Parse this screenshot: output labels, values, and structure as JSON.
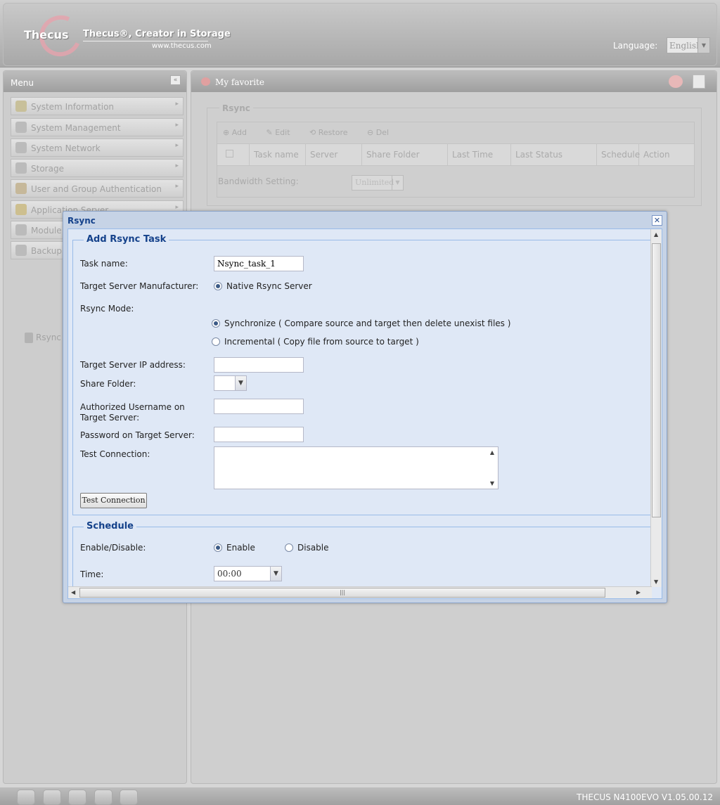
{
  "header": {
    "logo_text": "Thecus",
    "tagline": "Thecus®, Creator in Storage",
    "site_url": "www.thecus.com",
    "language_label": "Language:",
    "language_value": "English"
  },
  "menu": {
    "title": "Menu",
    "collapse_icon": "double-chevron-left",
    "items": [
      {
        "label": "System Information",
        "icon": "info-icon"
      },
      {
        "label": "System Management",
        "icon": "tools-icon"
      },
      {
        "label": "System Network",
        "icon": "network-icon"
      },
      {
        "label": "Storage",
        "icon": "storage-icon"
      },
      {
        "label": "User and Group Authentication",
        "icon": "users-icon"
      },
      {
        "label": "Application Server",
        "icon": "folder-icon"
      },
      {
        "label": "Module M",
        "icon": "gear-icon"
      },
      {
        "label": "Backup",
        "icon": "backup-icon"
      }
    ],
    "sub_item": "Rsync"
  },
  "main": {
    "favorite_label": "My favorite",
    "group_title": "Rsync",
    "toolbar": [
      "Add",
      "Edit",
      "Restore",
      "Del"
    ],
    "columns": [
      "Task name",
      "Server",
      "Share Folder",
      "Last Time",
      "Last Status",
      "Schedule",
      "Action"
    ],
    "bandwidth_label": "Bandwidth Setting:",
    "bandwidth_value": "Unlimited"
  },
  "dialog": {
    "title": "Rsync",
    "add_task_legend": "Add Rsync Task",
    "task_name_label": "Task name:",
    "task_name_value": "Nsync_task_1",
    "manufacturer_label": "Target Server Manufacturer:",
    "manufacturer_option": "Native Rsync Server",
    "mode_label": "Rsync Mode:",
    "mode_sync": "Synchronize ( Compare source and target then delete unexist files )",
    "mode_incremental": "Incremental ( Copy file from source to target )",
    "ip_label": "Target Server IP address:",
    "share_label": "Share Folder:",
    "username_label": "Authorized Username on Target Server:",
    "password_label": "Password on Target Server:",
    "test_label": "Test Connection:",
    "test_button": "Test Connection",
    "schedule_legend": "Schedule",
    "enable_label": "Enable/Disable:",
    "enable_option": "Enable",
    "disable_option": "Disable",
    "time_label": "Time:",
    "time_value": "00:00"
  },
  "footer": {
    "version": "THECUS N4100EVO V1.05.00.12"
  }
}
